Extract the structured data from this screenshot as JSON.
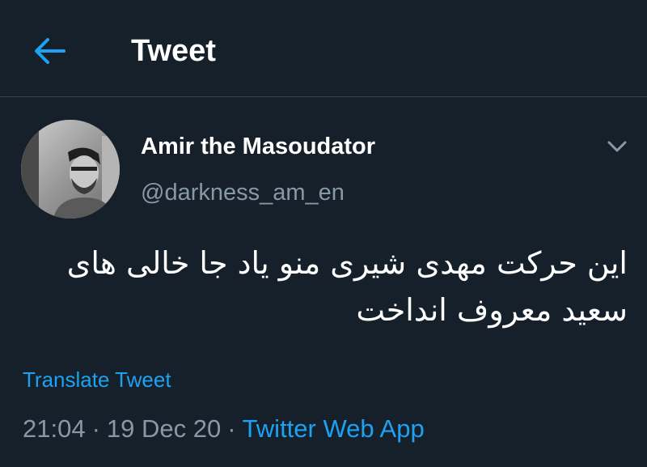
{
  "header": {
    "title": "Tweet",
    "back_icon": "arrow-left-icon"
  },
  "tweet": {
    "author": {
      "display_name": "Amir the Masoudator",
      "handle": "@darkness_am_en",
      "avatar_icon": "user-avatar"
    },
    "menu_icon": "chevron-down-icon",
    "text": "این حرکت مهدی شیری منو یاد جا خالی های سعید معروف انداخت",
    "translate_label": "Translate Tweet",
    "time": "21:04",
    "date": "19 Dec 20",
    "separator": "·",
    "source": "Twitter Web App"
  },
  "colors": {
    "background": "#15202b",
    "accent": "#1da1f2",
    "secondary_text": "#8899a6",
    "divider": "#38444d"
  }
}
